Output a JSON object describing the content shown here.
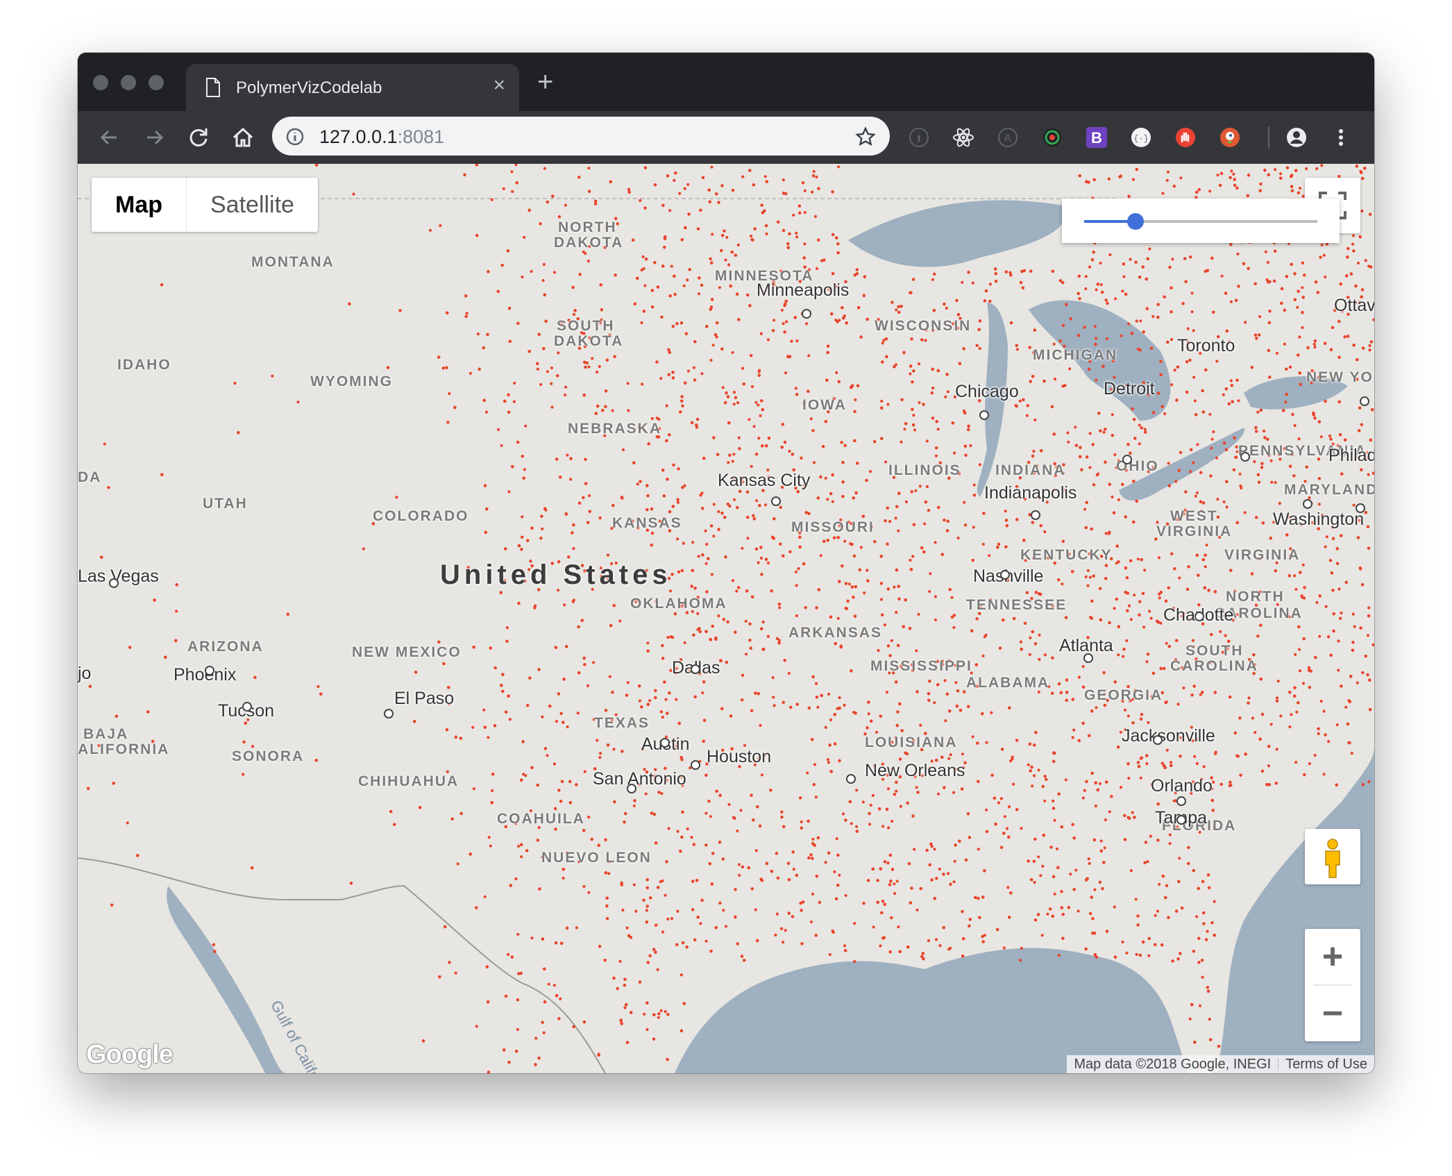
{
  "browser": {
    "tab_title": "PolymerVizCodelab",
    "tab_close": "×",
    "new_tab": "+",
    "url_host": "127.0.0.1",
    "url_port": ":8081"
  },
  "map": {
    "type_controls": {
      "map": "Map",
      "satellite": "Satellite",
      "selected": "Map"
    },
    "slider": {
      "value_fraction": 0.22,
      "accent_color": "#3f6fd8"
    },
    "zoom": {
      "in": "+",
      "out": "−"
    },
    "logo": "Google",
    "attribution": {
      "data": "Map data ©2018 Google, INEGI",
      "terms": "Terms of Use"
    },
    "point_color": "#e8452c",
    "country_label": "United States",
    "region_labels": [
      "MONTANA",
      "NORTH",
      "DAKOTA",
      "SOUTH",
      "DAKOTA",
      "MINNESOTA",
      "IDAHO",
      "WYOMING",
      "WISCONSIN",
      "MICHIGAN",
      "NEBRASKA",
      "UTAH",
      "COLORADO",
      "KANSAS",
      "MISSOURI",
      "ILLINOIS",
      "INDIANA",
      "OHIO",
      "PENNSYLVANIA",
      "WEST",
      "VIRGINIA",
      "VIRGINIA",
      "KENTUCKY",
      "TENNESSEE",
      "NORTH",
      "CAROLINA",
      "SOUTH",
      "CAROLINA",
      "ARIZONA",
      "NEW MEXICO",
      "OKLAHOMA",
      "ARKANSAS",
      "MISSISSIPPI",
      "ALABAMA",
      "GEORGIA",
      "TEXAS",
      "LOUISIANA",
      "FLORIDA",
      "SONORA",
      "CHIHUAHUA",
      "COAHUILA",
      "NUEVO LEON",
      "BAJA",
      "ALIFORNIA",
      "NEW YO",
      "MARYLAND",
      "DA",
      "IOWA"
    ],
    "city_labels": [
      "Minneapolis",
      "Chicago",
      "Detroit",
      "Toronto",
      "Ottav",
      "Kansas City",
      "Indianapolis",
      "Washington",
      "Philad",
      "Las Vegas",
      "Nashville",
      "Charlotte",
      "Atlanta",
      "Phoenix",
      "Tucson",
      "El Paso",
      "Dallas",
      "Austin",
      "Houston",
      "San Antonio",
      "New Orleans",
      "Jacksonville",
      "Orlando",
      "Tampa",
      "jo"
    ],
    "water_label": "Gulf of Califo"
  }
}
